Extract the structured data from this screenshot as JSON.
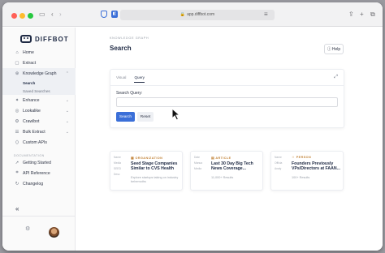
{
  "browser": {
    "url": "app.diffbot.com"
  },
  "sidebar": {
    "brand": "DIFFBOT",
    "items": [
      {
        "label": "Home",
        "icon": "home-icon"
      },
      {
        "label": "Extract",
        "icon": "extract-icon"
      },
      {
        "label": "Knowledge Graph",
        "icon": "graph-icon",
        "expanded": true
      },
      {
        "label": "Enhance",
        "icon": "enhance-icon"
      },
      {
        "label": "Lookalike",
        "icon": "lookalike-icon"
      },
      {
        "label": "Crawlbot",
        "icon": "crawlbot-icon"
      },
      {
        "label": "Bulk Extract",
        "icon": "bulk-icon"
      },
      {
        "label": "Custom APIs",
        "icon": "custom-icon"
      }
    ],
    "subitems": [
      {
        "label": "Search"
      },
      {
        "label": "Saved Searches"
      }
    ],
    "doc_section": "DOCUMENTATION",
    "doc_items": [
      {
        "label": "Getting Started",
        "icon": "rocket-icon"
      },
      {
        "label": "API Reference",
        "icon": "code-icon"
      },
      {
        "label": "Changelog",
        "icon": "changelog-icon"
      }
    ],
    "collapse": "«"
  },
  "main": {
    "breadcrumb": "KNOWLEDGE GRAPH",
    "title": "Search",
    "help": "Help",
    "tabs": [
      {
        "label": "Visual"
      },
      {
        "label": "Query"
      }
    ],
    "query_label": "Search Query:",
    "query_value": "",
    "search_button": "Search",
    "reset_button": "Reset"
  },
  "cards": [
    {
      "type": "ORGANIZATION",
      "title": "Seed Stage Companies Similar to CVS Health",
      "meta": "Explore startups taking on industry behemoths",
      "side": [
        "Name",
        "Media",
        "SEED",
        "Desc"
      ]
    },
    {
      "type": "ARTICLE",
      "title": "Last 30 Day Big Tech News Coverage...",
      "meta": "11,000+ Results",
      "side": [
        "Date",
        "Manua",
        "Media"
      ]
    },
    {
      "type": "PERSON",
      "title": "Founders Previously VPs/Directors at FAAN...",
      "meta": "100+ Results",
      "side": [
        "Name",
        "Officia",
        "Analy"
      ]
    }
  ],
  "colors": {
    "primary": "#3b6fd8",
    "accent": "#c2843a",
    "text": "#1f2a44"
  }
}
